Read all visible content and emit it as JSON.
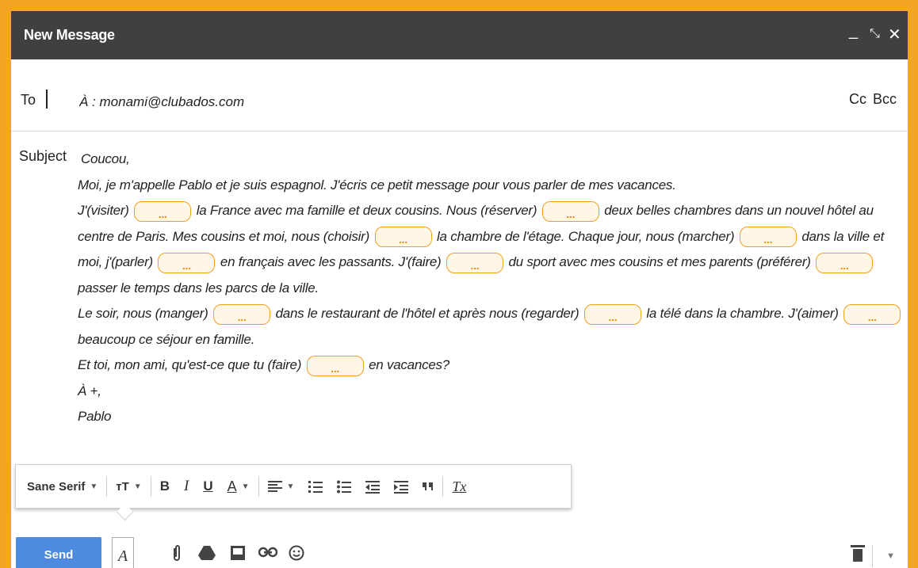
{
  "window": {
    "title": "New Message",
    "minimize_icon": "_",
    "popout_icon": "⤡",
    "close_icon": "✕"
  },
  "to": {
    "label": "To",
    "value": "À : monami@clubados.com",
    "cc": "Cc",
    "bcc": "Bcc"
  },
  "subject": {
    "label": "Subject"
  },
  "body": {
    "greeting": "Coucou,",
    "p1": "Moi, je m'appelle Pablo et je suis espagnol. J'écris ce petit message pour vous parler de mes vacances.",
    "p2_a": "J'(visiter)",
    "p2_b": "la France avec ma famille et deux cousins. Nous (réserver)",
    "p2_c": "deux belles chambres dans un nouvel hôtel au centre de Paris. Mes cousins et moi, nous (choisir)",
    "p2_d": "la chambre de l'étage. Chaque jour, nous (marcher)",
    "p2_e": "dans la ville et moi, j'(parler)",
    "p2_f": "en français avec les passants. J'(faire)",
    "p2_g": "du sport avec mes cousins et mes parents (préférer)",
    "p2_h": "passer le temps dans les parcs de la ville.",
    "p3_a": "Le soir, nous (manger)",
    "p3_b": "dans le restaurant de l'hôtel et après nous (regarder)",
    "p3_c": "la télé dans la chambre. J'(aimer)",
    "p3_d": "beaucoup ce séjour en famille.",
    "p4_a": "Et toi, mon ami, qu'est-ce que tu (faire)",
    "p4_b": "en vacances?",
    "closing": "À +,",
    "signature": "Pablo",
    "blank": "..."
  },
  "toolbar": {
    "font": "Sane Serif",
    "size_icon": "тT",
    "bold": "B",
    "italic": "I",
    "underline": "U",
    "text_color": "A",
    "clear": "Tx"
  },
  "bottom": {
    "send": "Send",
    "format": "A"
  },
  "colors": {
    "frame": "#f4a623",
    "titlebar": "#404040",
    "send": "#4d8ae0",
    "blank_border": "#f0a020"
  }
}
